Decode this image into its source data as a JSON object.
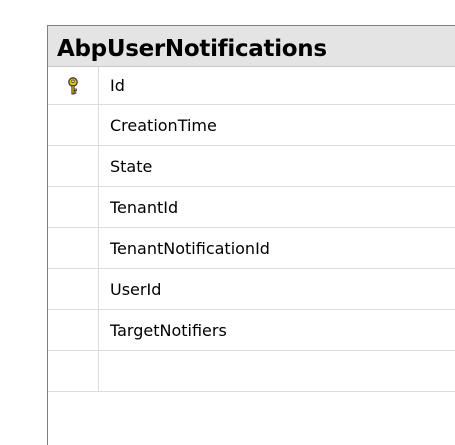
{
  "table": {
    "title": "AbpUserNotifications",
    "columns": [
      {
        "name": "Id",
        "primary_key": true,
        "icon": "primary-key-icon"
      },
      {
        "name": "CreationTime",
        "primary_key": false
      },
      {
        "name": "State",
        "primary_key": false
      },
      {
        "name": "TenantId",
        "primary_key": false
      },
      {
        "name": "TenantNotificationId",
        "primary_key": false
      },
      {
        "name": "UserId",
        "primary_key": false
      },
      {
        "name": "TargetNotifiers",
        "primary_key": false
      }
    ]
  },
  "colors": {
    "title_bar": "#e4e4e4",
    "border": "#808080",
    "key_gold": "#e8c200"
  }
}
